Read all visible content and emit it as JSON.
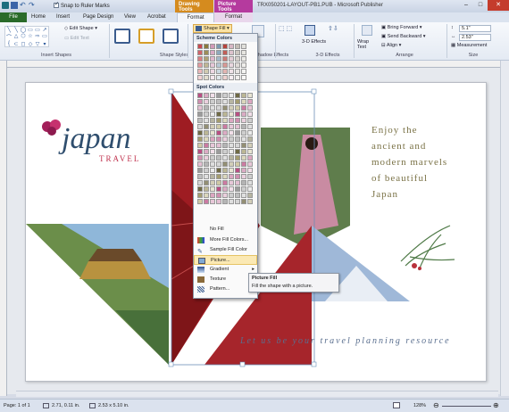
{
  "window": {
    "title": "TRX050201-LAYOUT-PB1.PUB - Microsoft Publisher",
    "snap_label": "Snap to Ruler Marks",
    "context_drawing": "Drawing Tools",
    "context_picture": "Picture Tools"
  },
  "tabs": [
    "File",
    "Home",
    "Insert",
    "Page Design",
    "View",
    "Acrobat",
    "Format",
    "Format"
  ],
  "ribbon": {
    "edit_shape": "Edit Shape",
    "edit_text": "Edit Text",
    "insert_shapes": "Insert Shapes",
    "shape_styles": "Shape Styles",
    "shadow_effects": "hadow Effects",
    "three_d_effects_btn": "3-D Effects",
    "three_d_effects_group": "3-D Effects",
    "wrap_text": "Wrap Text",
    "bring_forward": "Bring Forward",
    "send_backward": "Send Backward",
    "align": "Align",
    "arrange": "Arrange",
    "height": "5.1\"",
    "width": "2.53\"",
    "measurement": "Measurement",
    "size": "Size"
  },
  "shape_fill": {
    "button": "Shape Fill",
    "scheme_colors": "Scheme Colors",
    "spot_colors": "Spot Colors",
    "items": [
      "No Fill",
      "More Fill Colors...",
      "Sample Fill Color",
      "Picture...",
      "Gradient",
      "Texture",
      "Pattern..."
    ],
    "highlighted": "Picture...",
    "scheme_swatch_colors": [
      "#ffffff",
      "#000000",
      "#c9484e",
      "#8a7a3a",
      "#d29ab8",
      "#7b9ab0",
      "#b6443c",
      "#d7b7c4",
      "#c3bcb4",
      "#e1e0db"
    ],
    "spot_swatch_colors": [
      "#b94f83",
      "#cf8fb0",
      "#e3bfd2",
      "#9b9b9b",
      "#bdbdbd",
      "#d6d6d6",
      "#6f6a45",
      "#a49d70",
      "#cfc9a5"
    ]
  },
  "tooltip": {
    "title": "Picture Fill",
    "body": "Fill the shape with a picture."
  },
  "page": {
    "logo": "japan",
    "logo_sub": "TRAVEL",
    "enjoy": [
      "Enjoy the",
      "ancient and",
      "modern marvels",
      "of beautiful",
      "Japan"
    ],
    "tagline": "Let us be your travel planning resource"
  },
  "status": {
    "page": "Page: 1 of 1",
    "position": "2.71, 0.11 in.",
    "size": "2.53 x 5.10 in.",
    "zoom": "128%"
  }
}
